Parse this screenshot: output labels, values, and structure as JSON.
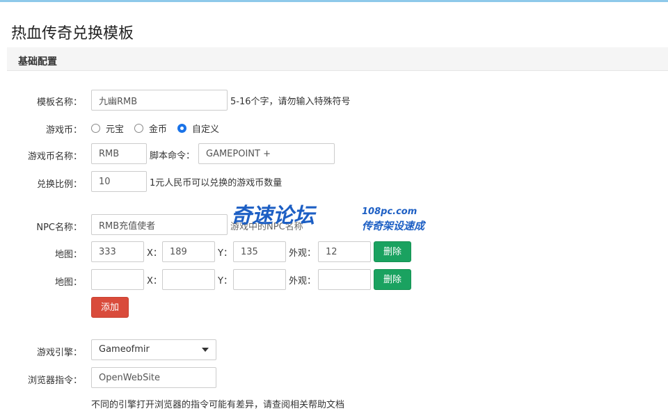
{
  "page": {
    "title": "热血传奇兑换模板"
  },
  "panel": {
    "title": "基础配置"
  },
  "form": {
    "template_name": {
      "label": "模板名称：",
      "value": "九幽RMB",
      "hint": "5-16个字，请勿输入特殊符号"
    },
    "currency": {
      "label": "游戏币：",
      "options": [
        {
          "label": "元宝",
          "checked": false
        },
        {
          "label": "金币",
          "checked": false
        },
        {
          "label": "自定义",
          "checked": true
        }
      ]
    },
    "currency_name": {
      "label": "游戏币名称：",
      "value": "RMB"
    },
    "script_cmd": {
      "label": "脚本命令：",
      "value": "GAMEPOINT +"
    },
    "ratio": {
      "label": "兑换比例：",
      "value": "10",
      "hint": "1元人民币可以兑换的游戏币数量"
    },
    "npc_name": {
      "label": "NPC名称：",
      "value": "RMB充值使者",
      "hint": "游戏中的NPC名称"
    },
    "maps": [
      {
        "label": "地图：",
        "map": "333",
        "x_label": "X：",
        "x": "189",
        "y_label": "Y：",
        "y": "135",
        "look_label": "外观：",
        "look": "12",
        "delete_label": "删除"
      },
      {
        "label": "地图：",
        "map": "",
        "x_label": "X：",
        "x": "",
        "y_label": "Y：",
        "y": "",
        "look_label": "外观：",
        "look": "",
        "delete_label": "删除"
      }
    ],
    "add_label": "添加",
    "engine": {
      "label": "游戏引擎：",
      "selected": "Gameofmir"
    },
    "browser_cmd": {
      "label": "浏览器指令：",
      "value": "OpenWebSite",
      "hint": "不同的引擎打开浏览器的指令可能有差异，请查阅相关帮助文档"
    }
  },
  "watermark": {
    "main": "奇速论坛",
    "domain": "108pc.com",
    "sub": "传奇架设速成"
  },
  "colors": {
    "accent_green": "#1aa260",
    "accent_red": "#d94b3b",
    "radio_blue": "#1a73e8",
    "top_bar": "#8ec9ea"
  }
}
